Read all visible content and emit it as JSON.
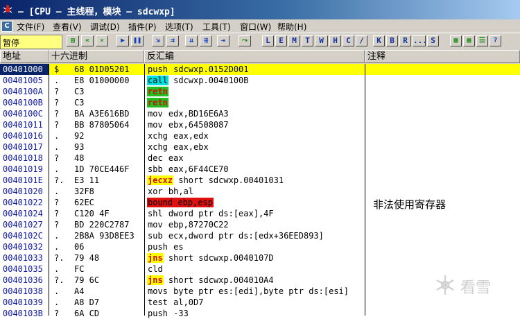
{
  "window": {
    "title": "– [CPU – 主线程，模块 – sdcwxp]"
  },
  "menu": [
    "文件(F)",
    "查看(V)",
    "调试(D)",
    "插件(P)",
    "选项(T)",
    "工具(T)",
    "窗口(W)",
    "帮助(H)"
  ],
  "toolbar": {
    "status": "暂停",
    "letter_buttons": [
      "L",
      "E",
      "M",
      "T",
      "W",
      "H",
      "C",
      "/",
      "K",
      "B",
      "R",
      "...",
      "S"
    ]
  },
  "columns": {
    "address": "地址",
    "hex": "十六进制",
    "disasm": "反汇编",
    "comment": "注释"
  },
  "rows": [
    {
      "addr": "00401000",
      "mark": "$",
      "hex": "68 01D05201",
      "mn": "push",
      "ops": " sdcwxp.0152D001",
      "hl": ""
    },
    {
      "addr": "00401005",
      "mark": ".",
      "hex": "E8 01000000",
      "mn": "call",
      "ops": " sdcwxp.0040100B",
      "hl": "cyan"
    },
    {
      "addr": "0040100A",
      "mark": "?",
      "hex": "C3",
      "mn": "retn",
      "ops": "",
      "hl": "green"
    },
    {
      "addr": "0040100B",
      "mark": "?",
      "hex": "C3",
      "mn": "retn",
      "ops": "",
      "hl": "green"
    },
    {
      "addr": "0040100C",
      "mark": "?",
      "hex": "BA A3E616BD",
      "mn": "mov",
      "ops": " edx,BD16E6A3",
      "hl": ""
    },
    {
      "addr": "00401011",
      "mark": "?",
      "hex": "BB 87805064",
      "mn": "mov",
      "ops": " ebx,64508087",
      "hl": ""
    },
    {
      "addr": "00401016",
      "mark": ".",
      "hex": "92",
      "mn": "xchg",
      "ops": " eax,edx",
      "hl": ""
    },
    {
      "addr": "00401017",
      "mark": ".",
      "hex": "93",
      "mn": "xchg",
      "ops": " eax,ebx",
      "hl": ""
    },
    {
      "addr": "00401018",
      "mark": "?",
      "hex": "48",
      "mn": "dec",
      "ops": " eax",
      "hl": ""
    },
    {
      "addr": "00401019",
      "mark": ".",
      "hex": "1D 70CE446F",
      "mn": "sbb",
      "ops": " eax,6F44CE70",
      "hl": ""
    },
    {
      "addr": "0040101E",
      "mark": "?.",
      "hex": "E3 11",
      "mn": "jecxz",
      "ops": " short sdcwxp.00401031",
      "hl": "yellow"
    },
    {
      "addr": "00401020",
      "mark": ".",
      "hex": "32F8",
      "mn": "xor",
      "ops": " bh,al",
      "hl": ""
    },
    {
      "addr": "00401022",
      "mark": "?",
      "hex": "62EC",
      "mn": "bound ebp,esp",
      "ops": "",
      "hl": "red"
    },
    {
      "addr": "00401024",
      "mark": "?",
      "hex": "C120 4F",
      "mn": "shl",
      "ops": " dword ptr ds:[eax],4F",
      "hl": ""
    },
    {
      "addr": "00401027",
      "mark": "?",
      "hex": "BD 220C2787",
      "mn": "mov",
      "ops": " ebp,87270C22",
      "hl": ""
    },
    {
      "addr": "0040102C",
      "mark": ".",
      "hex": "2B8A 93D8EE3",
      "mn": "sub",
      "ops": " ecx,dword ptr ds:[edx+36EED893]",
      "hl": ""
    },
    {
      "addr": "00401032",
      "mark": ".",
      "hex": "06",
      "mn": "push",
      "ops": " es",
      "hl": ""
    },
    {
      "addr": "00401033",
      "mark": "?.",
      "hex": "79 48",
      "mn": "jns",
      "ops": " short sdcwxp.0040107D",
      "hl": "yellow"
    },
    {
      "addr": "00401035",
      "mark": ".",
      "hex": "FC",
      "mn": "cld",
      "ops": "",
      "hl": ""
    },
    {
      "addr": "00401036",
      "mark": "?.",
      "hex": "79 6C",
      "mn": "jns",
      "ops": " short sdcwxp.004010A4",
      "hl": "yellow"
    },
    {
      "addr": "00401038",
      "mark": ".",
      "hex": "A4",
      "mn": "movs",
      "ops": " byte ptr es:[edi],byte ptr ds:[esi]",
      "hl": ""
    },
    {
      "addr": "00401039",
      "mark": ".",
      "hex": "A8 D7",
      "mn": "test",
      "ops": " al,0D7",
      "hl": ""
    },
    {
      "addr": "0040103B",
      "mark": "?",
      "hex": "6A CD",
      "mn": "push",
      "ops": " -33",
      "hl": ""
    }
  ],
  "comment_note": "非法使用寄存器",
  "watermark": "看雪",
  "colors": {
    "selected_row": "#ffff00",
    "selected_addr": "#0a246a",
    "addr_text": "#1018a0"
  }
}
